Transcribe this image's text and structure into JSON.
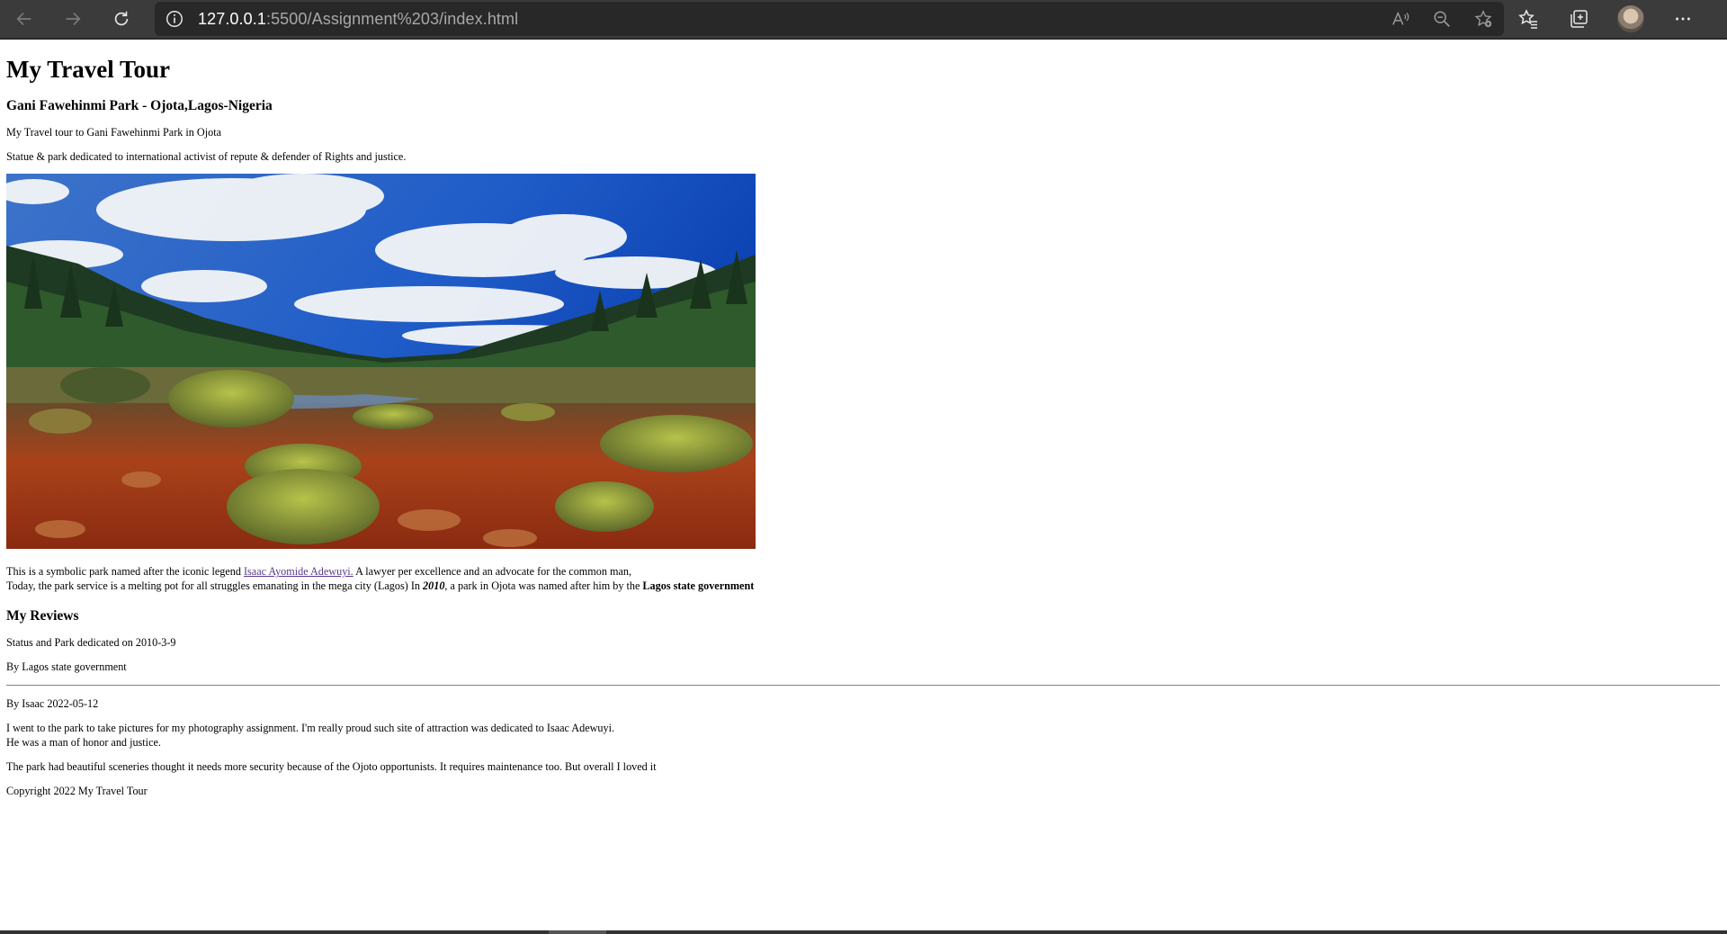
{
  "browser": {
    "url_host": "127.0.0.1",
    "url_rest": ":5500/Assignment%203/index.html",
    "icons": {
      "back": "back-arrow-icon",
      "forward": "forward-arrow-icon",
      "refresh": "refresh-icon",
      "info": "info-icon",
      "read_aloud": "read-aloud-icon",
      "zoom": "zoom-out-icon",
      "favorite": "add-favorite-icon",
      "favorites": "favorites-icon",
      "collections": "collections-icon",
      "profile": "profile-avatar",
      "more": "more-icon"
    },
    "colors": {
      "toolbar": "#3b3b3b",
      "address_bar": "#282828"
    }
  },
  "page": {
    "title": "My Travel Tour",
    "subtitle": "Gani Fawehinmi Park - Ojota,Lagos-Nigeria",
    "intro1": "My Travel tour to Gani Fawehinmi Park in Ojota",
    "intro2": "Statue & park dedicated to international activist of repute & defender of Rights and justice.",
    "desc_line1_before": "This is a symbolic park named after the iconic legend ",
    "desc_link": "Isaac Ayomide Adewuyi.",
    "desc_line1_after": " A lawyer per excellence and an advocate for the common man,",
    "desc_line2_before": "Today, the park service is a melting pot for all struggles emanating in the mega city (Lagos) In ",
    "desc_year": "2010",
    "desc_line2_mid": ", a park in Ojota was named after him by the ",
    "desc_gov": "Lagos state government",
    "reviews_heading": "My Reviews",
    "review_date": "Status and Park dedicated on 2010-3-9",
    "review_by": "By Lagos state government",
    "author_line": "By Isaac 2022-05-12",
    "review_text1": "I went to the park to take pictures for my photography assignment. I'm really proud such site of attraction was dedicated to Isaac Adewuyi.",
    "review_text2": "He was a man of honor and justice.",
    "review_text3": "The park had beautiful sceneries thought it needs more security because of the Ojoto opportunists. It requires maintenance too. But overall I loved it",
    "copyright": "Copyright 2022 My Travel Tour"
  }
}
